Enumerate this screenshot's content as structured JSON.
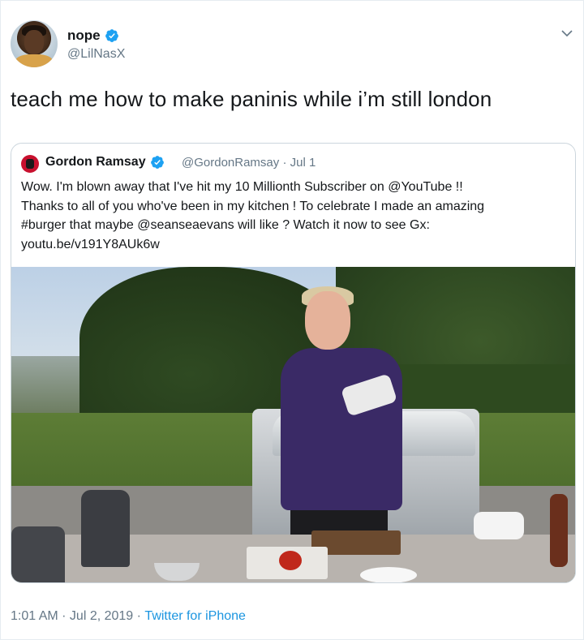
{
  "tweet": {
    "author_name": "nope",
    "author_handle": "@LilNasX",
    "verified_icon": "verified-badge-icon",
    "menu_icon": "chevron-down-icon",
    "text": "teach me how to make paninis while i’m still london"
  },
  "quoted_tweet": {
    "author_name": "Gordon Ramsay",
    "author_handle": "@GordonRamsay",
    "separator": "·",
    "date": "Jul 1",
    "lines": [
      "Wow. I'm blown away that I've hit my 10 Millionth Subscriber on @YouTube !!",
      "Thanks to all of you who've been in my kitchen ! To celebrate I made an amazing",
      "#burger that maybe @seanseaevans will like ? Watch it now to see Gx:",
      "youtu.be/v191Y8AUk6w"
    ]
  },
  "footer": {
    "time": "1:01 AM",
    "separator": " · ",
    "date": "Jul 2, 2019",
    "separator2": " · ",
    "source": "Twitter for iPhone"
  },
  "colors": {
    "text_primary": "#14171a",
    "text_secondary": "#657786",
    "link": "#1b95e0",
    "verified": "#1da1f2",
    "border": "#ccd6dd"
  }
}
